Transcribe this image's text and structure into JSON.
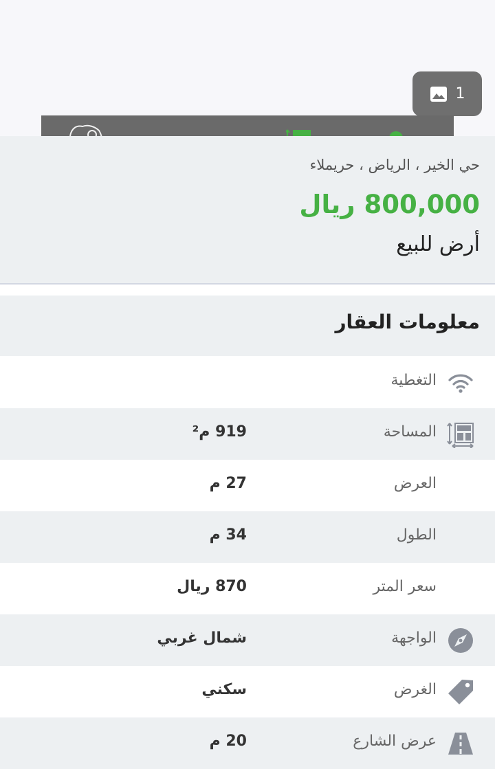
{
  "gallery": {
    "photo_count": "1",
    "photo_icon": "image-icon"
  },
  "action_bar": {
    "icons": [
      "map-outline-icon",
      "green-action-icon",
      "green-area-icon",
      "green-circle-icon"
    ],
    "accent": "#46b144"
  },
  "summary": {
    "location": "حي الخير ، الرياض ، حريملاء",
    "price": "800,000 ريال",
    "title": "أرض للبيع",
    "price_color": "#46b144"
  },
  "property_info": {
    "heading": "معلومات العقار",
    "rows": [
      {
        "label": "التغطية",
        "value": "",
        "icon": "wifi-icon"
      },
      {
        "label": "المساحة",
        "value": "919 م²",
        "icon": "area-icon"
      },
      {
        "label": "العرض",
        "value": "27 م",
        "icon": ""
      },
      {
        "label": "الطول",
        "value": "34 م",
        "icon": ""
      },
      {
        "label": "سعر المتر",
        "value": "870 ريال",
        "icon": ""
      },
      {
        "label": "الواجهة",
        "value": "شمال غربي",
        "icon": "compass-icon"
      },
      {
        "label": "الغرض",
        "value": "سكني",
        "icon": "tag-icon"
      },
      {
        "label": "عرض الشارع",
        "value": "20 م",
        "icon": "road-icon"
      }
    ]
  }
}
